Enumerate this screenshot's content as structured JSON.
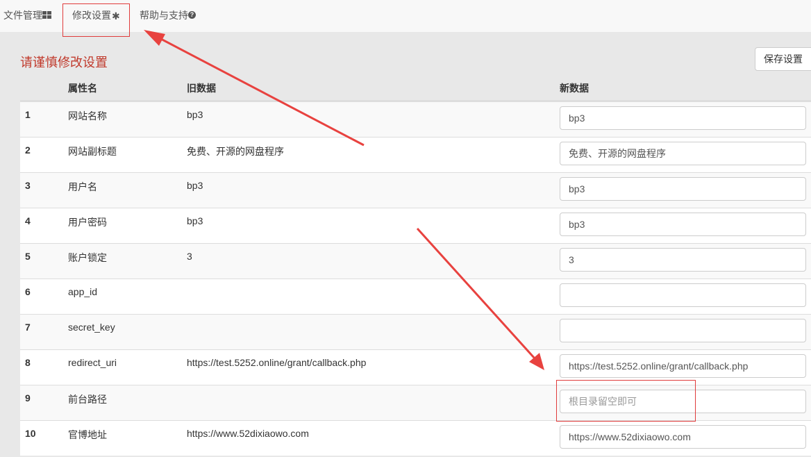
{
  "nav": {
    "items": [
      {
        "label": "文件管理",
        "icon": "grid-icon"
      },
      {
        "label": "修改设置",
        "icon": "gear-icon",
        "active": true
      },
      {
        "label": "帮助与支持",
        "icon": "question-circle-icon"
      }
    ]
  },
  "page": {
    "title": "请谨慎修改设置",
    "save_label": "保存设置"
  },
  "table": {
    "headers": [
      "",
      "属性名",
      "旧数据",
      "新数据"
    ],
    "rows": [
      {
        "num": "1",
        "attr": "网站名称",
        "old": "bp3",
        "new": "bp3",
        "placeholder": ""
      },
      {
        "num": "2",
        "attr": "网站副标题",
        "old": "免费、开源的网盘程序",
        "new": "免费、开源的网盘程序",
        "placeholder": ""
      },
      {
        "num": "3",
        "attr": "用户名",
        "old": "bp3",
        "new": "bp3",
        "placeholder": ""
      },
      {
        "num": "4",
        "attr": "用户密码",
        "old": "bp3",
        "new": "bp3",
        "placeholder": ""
      },
      {
        "num": "5",
        "attr": "账户锁定",
        "old": "3",
        "new": "3",
        "placeholder": ""
      },
      {
        "num": "6",
        "attr": "app_id",
        "old": "",
        "new": "",
        "placeholder": ""
      },
      {
        "num": "7",
        "attr": "secret_key",
        "old": "",
        "new": "",
        "placeholder": ""
      },
      {
        "num": "8",
        "attr": "redirect_uri",
        "old": "https://test.5252.online/grant/callback.php",
        "new": "https://test.5252.online/grant/callback.php",
        "placeholder": ""
      },
      {
        "num": "9",
        "attr": "前台路径",
        "old": "",
        "new": "",
        "placeholder": "根目录留空即可"
      },
      {
        "num": "10",
        "attr": "官博地址",
        "old": "https://www.52dixiaowo.com",
        "new": "https://www.52dixiaowo.com",
        "placeholder": ""
      }
    ]
  },
  "annotation_color": "#e8423f"
}
